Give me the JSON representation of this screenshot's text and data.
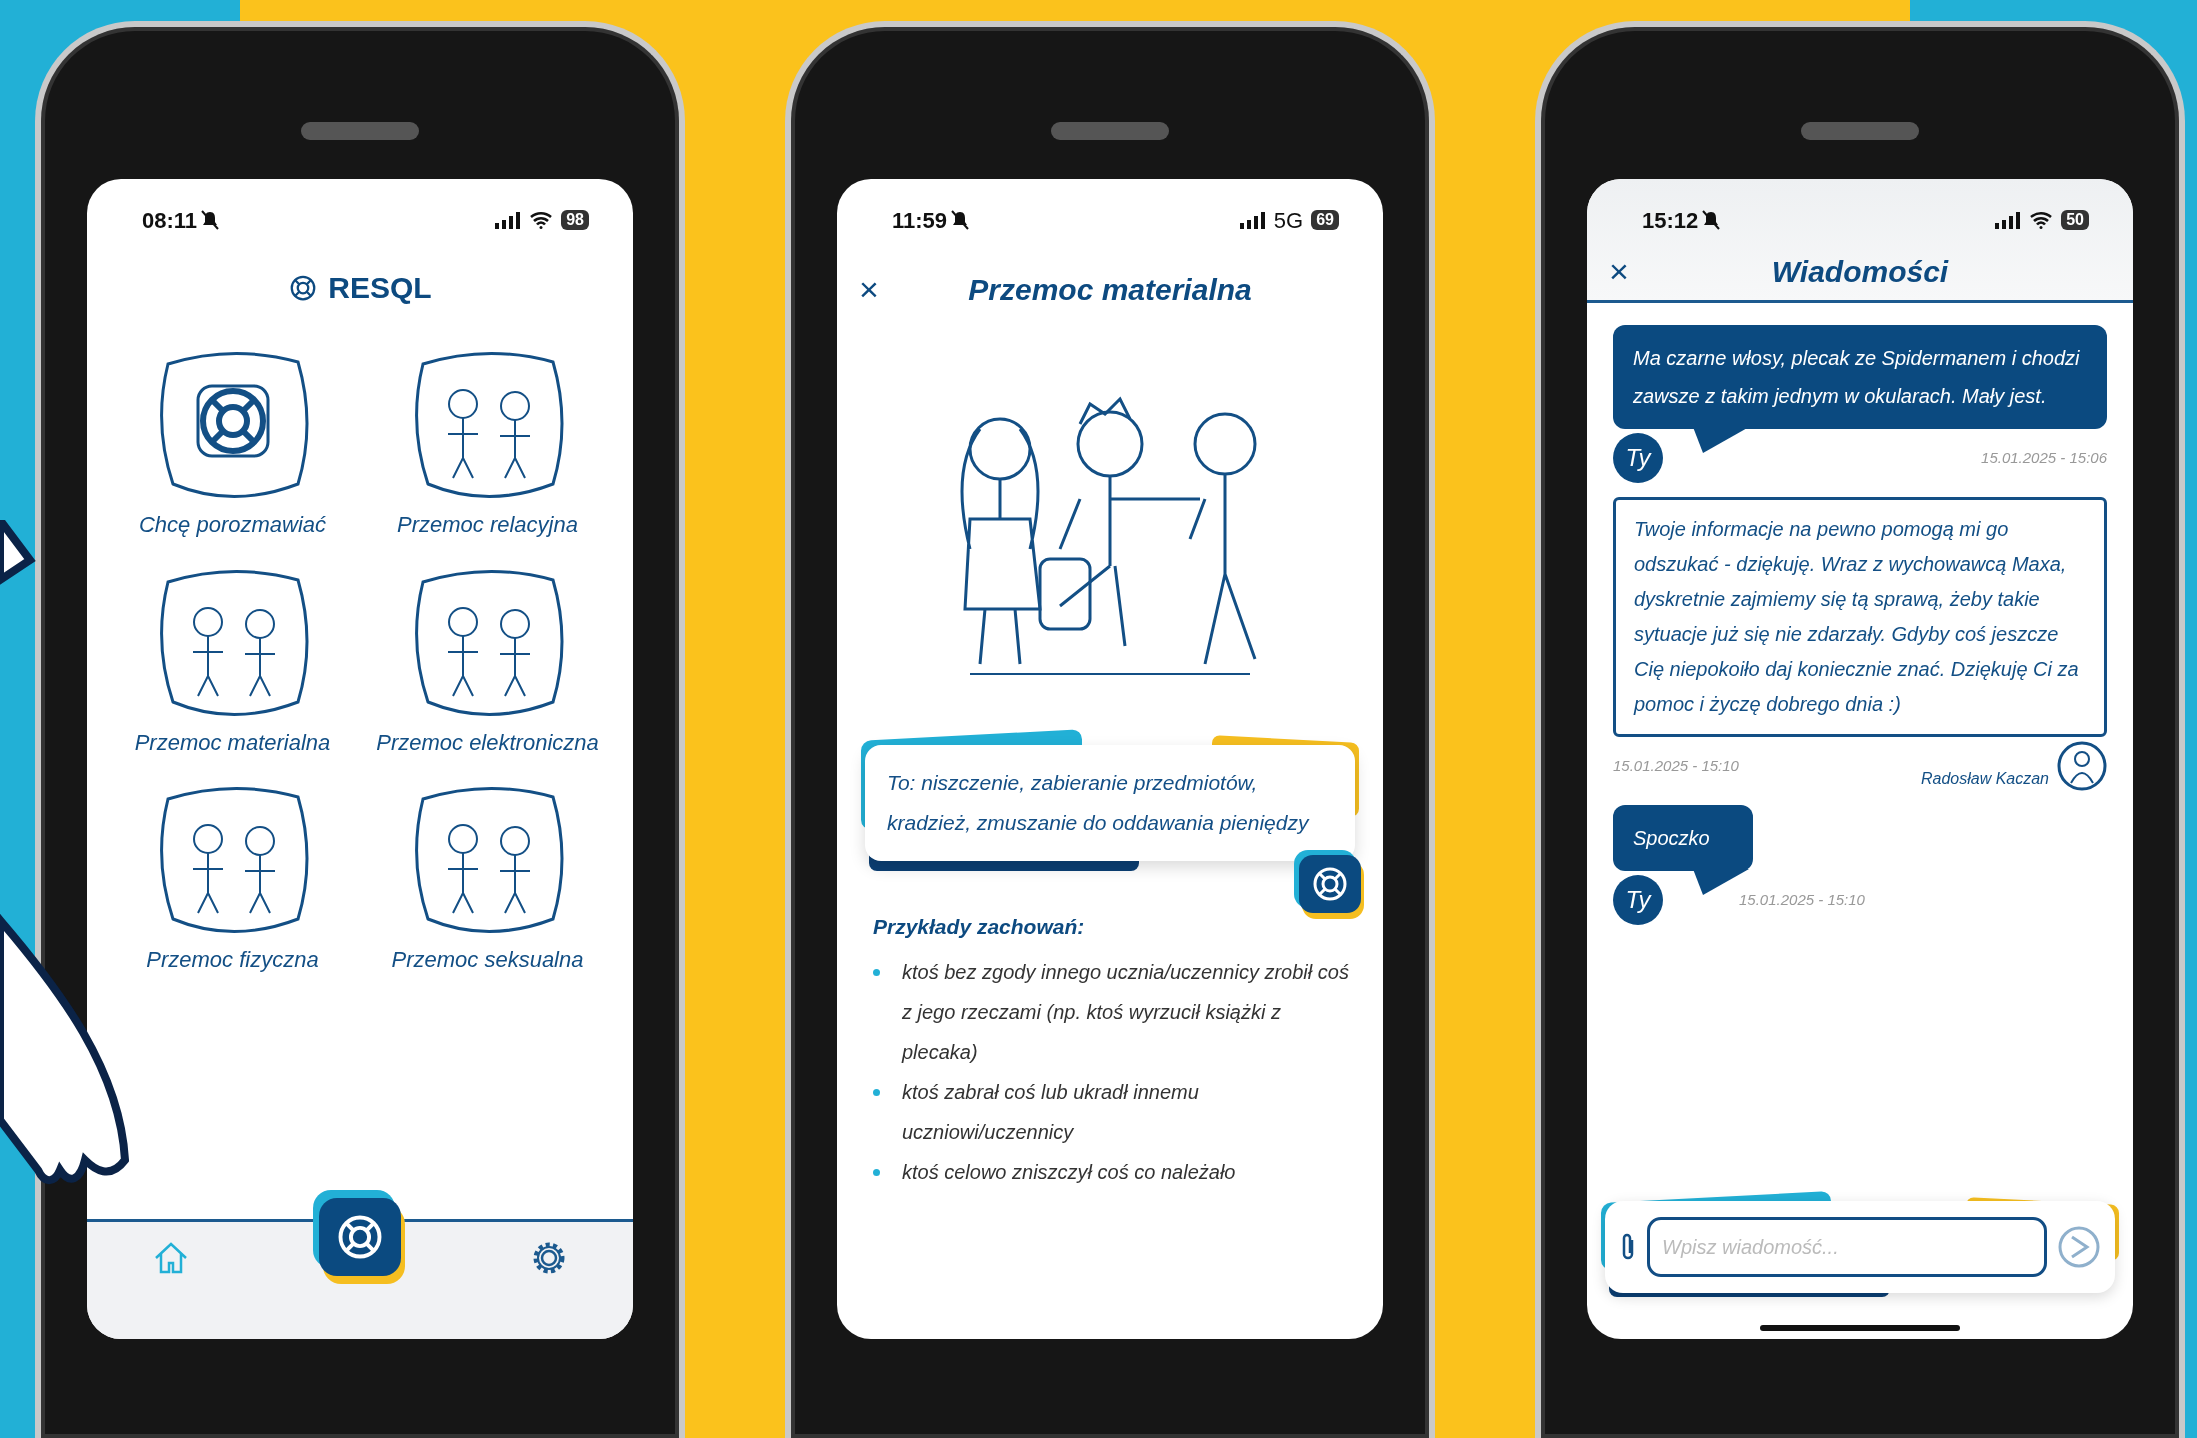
{
  "phones": [
    {
      "kind": "home",
      "status": {
        "time": "08:11",
        "wifi": true,
        "battery": "98"
      },
      "logo": "RESQL",
      "tiles": [
        {
          "label": "Chcę porozmawiać",
          "kind": "icon"
        },
        {
          "label": "Przemoc relacyjna",
          "kind": "scene"
        },
        {
          "label": "Przemoc materialna",
          "kind": "scene"
        },
        {
          "label": "Przemoc elektroniczna",
          "kind": "scene"
        },
        {
          "label": "Przemoc fizyczna",
          "kind": "scene"
        },
        {
          "label": "Przemoc seksualna",
          "kind": "scene"
        }
      ],
      "nav": [
        {
          "kind": "home",
          "selected": true
        },
        {
          "kind": "help",
          "selected": false
        },
        {
          "kind": "settings",
          "selected": false
        }
      ]
    },
    {
      "kind": "article",
      "status": {
        "time": "11:59",
        "network": "5G",
        "wifi": false,
        "battery": "69"
      },
      "close": "×",
      "title": "Przemoc materialna",
      "definition": "To: niszczenie, zabieranie przedmiotów, kradzież, zmuszanie do oddawania pieniędzy",
      "examples_heading": "Przykłady zachowań:",
      "examples": [
        "ktoś bez zgody innego ucznia/uczennicy zrobił coś z jego rzeczami (np. ktoś wyrzucił książki z plecaka)",
        "ktoś zabrał coś lub ukradł innemu uczniowi/uczennicy",
        "ktoś celowo zniszczył coś co należało"
      ]
    },
    {
      "kind": "chat",
      "status": {
        "time": "15:12",
        "wifi": true,
        "battery": "50"
      },
      "close": "×",
      "title": "Wiadomości",
      "messages": [
        {
          "kind": "outgoing",
          "sender": "Ty",
          "text": "Ma czarne włosy, plecak ze Spidermanem i chodzi zawsze z takim jednym w okularach. Mały jest.",
          "time": "15.01.2025 - 15:06"
        },
        {
          "kind": "incoming",
          "sender": "Radosław Kaczan",
          "text": "Twoje informacje na pewno pomogą mi go odszukać - dziękuję.  Wraz z wychowawcą Maxa, dyskretnie zajmiemy się tą sprawą, żeby takie sytuacje już się nie zdarzały. Gdyby coś jeszcze Cię niepokoiło daj koniecznie znać. Dziękuję Ci za pomoc i życzę dobrego dnia :)",
          "time": "15.01.2025 - 15:10"
        },
        {
          "kind": "outgoing",
          "sender": "Ty",
          "text": "Spoczko",
          "time": "15.01.2025 - 15:10"
        }
      ],
      "composer": {
        "placeholder": "Wpisz wiadomość..."
      }
    }
  ]
}
